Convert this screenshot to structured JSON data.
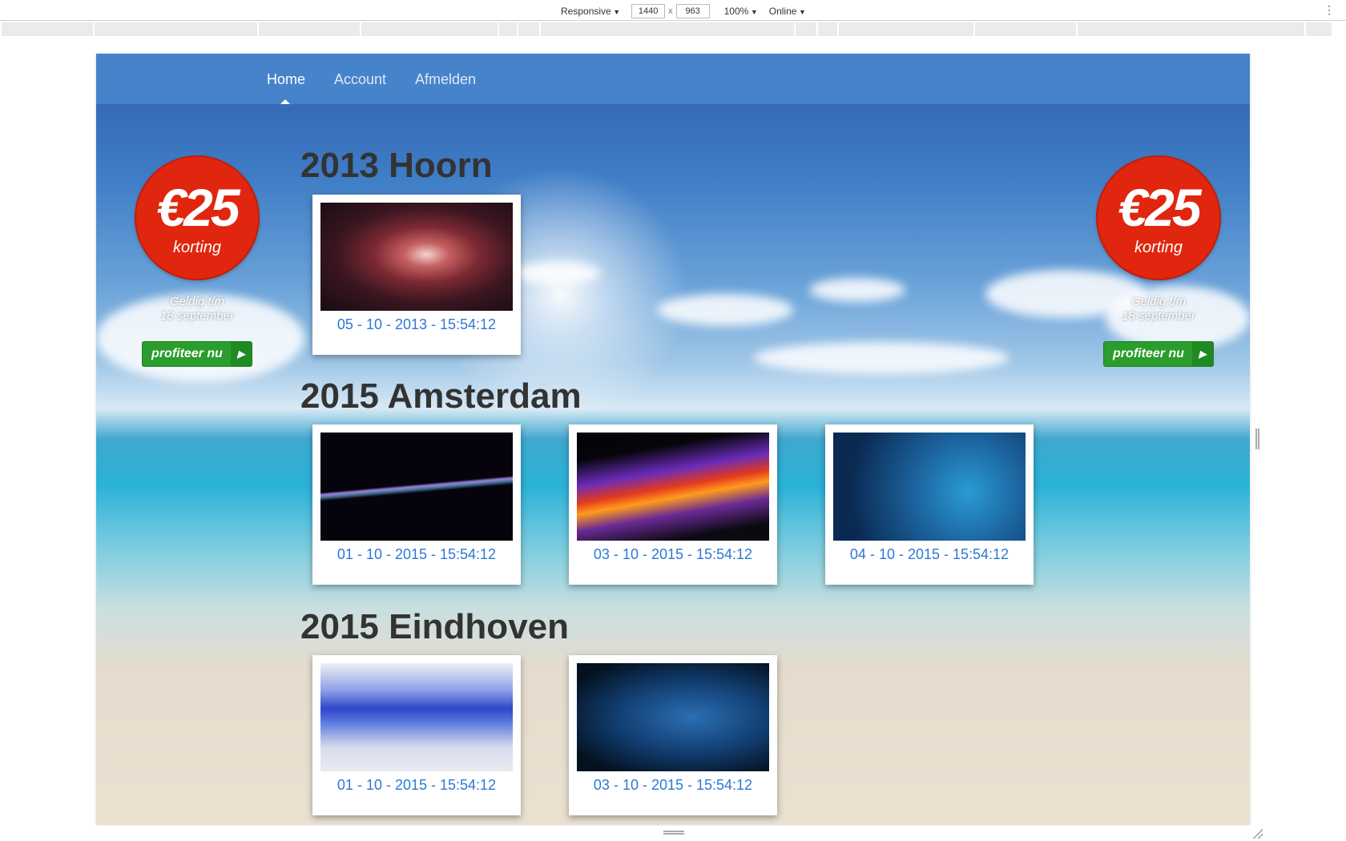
{
  "devtools": {
    "device_mode": "Responsive",
    "width": "1440",
    "height": "963",
    "times": "x",
    "zoom": "100%",
    "network": "Online",
    "menu_glyph": "⋮"
  },
  "nav": {
    "items": [
      {
        "label": "Home",
        "active": true
      },
      {
        "label": "Account",
        "active": false
      },
      {
        "label": "Afmelden",
        "active": false
      }
    ]
  },
  "promo": {
    "amount": "€25",
    "subtitle": "korting",
    "valid_line1": "Geldig t/m",
    "valid_line2": "18 september",
    "cta": "profiteer nu",
    "cta_arrow": "▶",
    "brand_color": "#e0260e",
    "cta_color": "#2a9d2c"
  },
  "sections": [
    {
      "title": "2013 Hoorn",
      "photos": [
        {
          "date": "05 - 10 - 2013 - 15:54:12",
          "image": "galaxy"
        }
      ]
    },
    {
      "title": "2015 Amsterdam",
      "photos": [
        {
          "date": "01 - 10 - 2015 - 15:54:12",
          "image": "light-wave"
        },
        {
          "date": "03 - 10 - 2015 - 15:54:12",
          "image": "fire-smoke"
        },
        {
          "date": "04 - 10 - 2015 - 15:54:12",
          "image": "underwater-diver"
        }
      ]
    },
    {
      "title": "2015 Eindhoven",
      "photos": [
        {
          "date": "01 - 10 - 2015 - 15:54:12",
          "image": "blue-smoke"
        },
        {
          "date": "03 - 10 - 2015 - 15:54:12",
          "image": "sports-car"
        }
      ]
    }
  ],
  "colors": {
    "navbar": "#4885cc",
    "date_link": "#2d78d6",
    "heading": "#333333"
  }
}
